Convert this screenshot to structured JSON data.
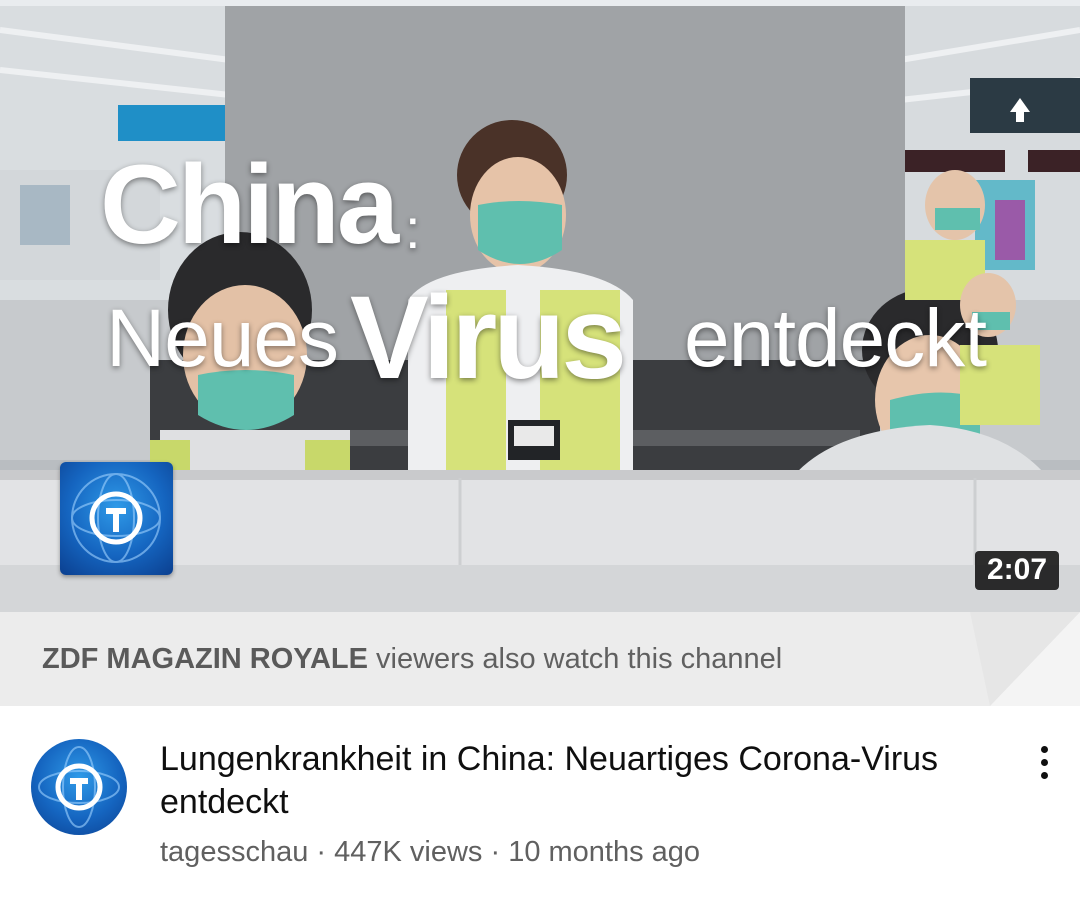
{
  "thumbnail": {
    "overlay_title_line1": "China",
    "overlay_colon": ":",
    "overlay_word_neues": "Neues",
    "overlay_word_virus": "Virus",
    "overlay_word_entdeckt": "entdeckt",
    "duration": "2:07",
    "channel_logo_icon": "tagesschau-logo-icon"
  },
  "recommendation_banner": {
    "channel": "ZDF MAGAZIN ROYALE",
    "text": " viewers also watch this channel"
  },
  "video": {
    "title": "Lungenkrankheit in China: Neuartiges Corona-Virus entdeckt",
    "channel": "tagesschau",
    "separator": " · ",
    "views": "447K views",
    "age": "10 months ago",
    "avatar_icon": "tagesschau-avatar-icon",
    "menu_icon": "more-vertical-icon"
  },
  "colors": {
    "mask": "#5fbfae",
    "vest": "#d6e27a",
    "logo_blue": "#1565c0"
  }
}
